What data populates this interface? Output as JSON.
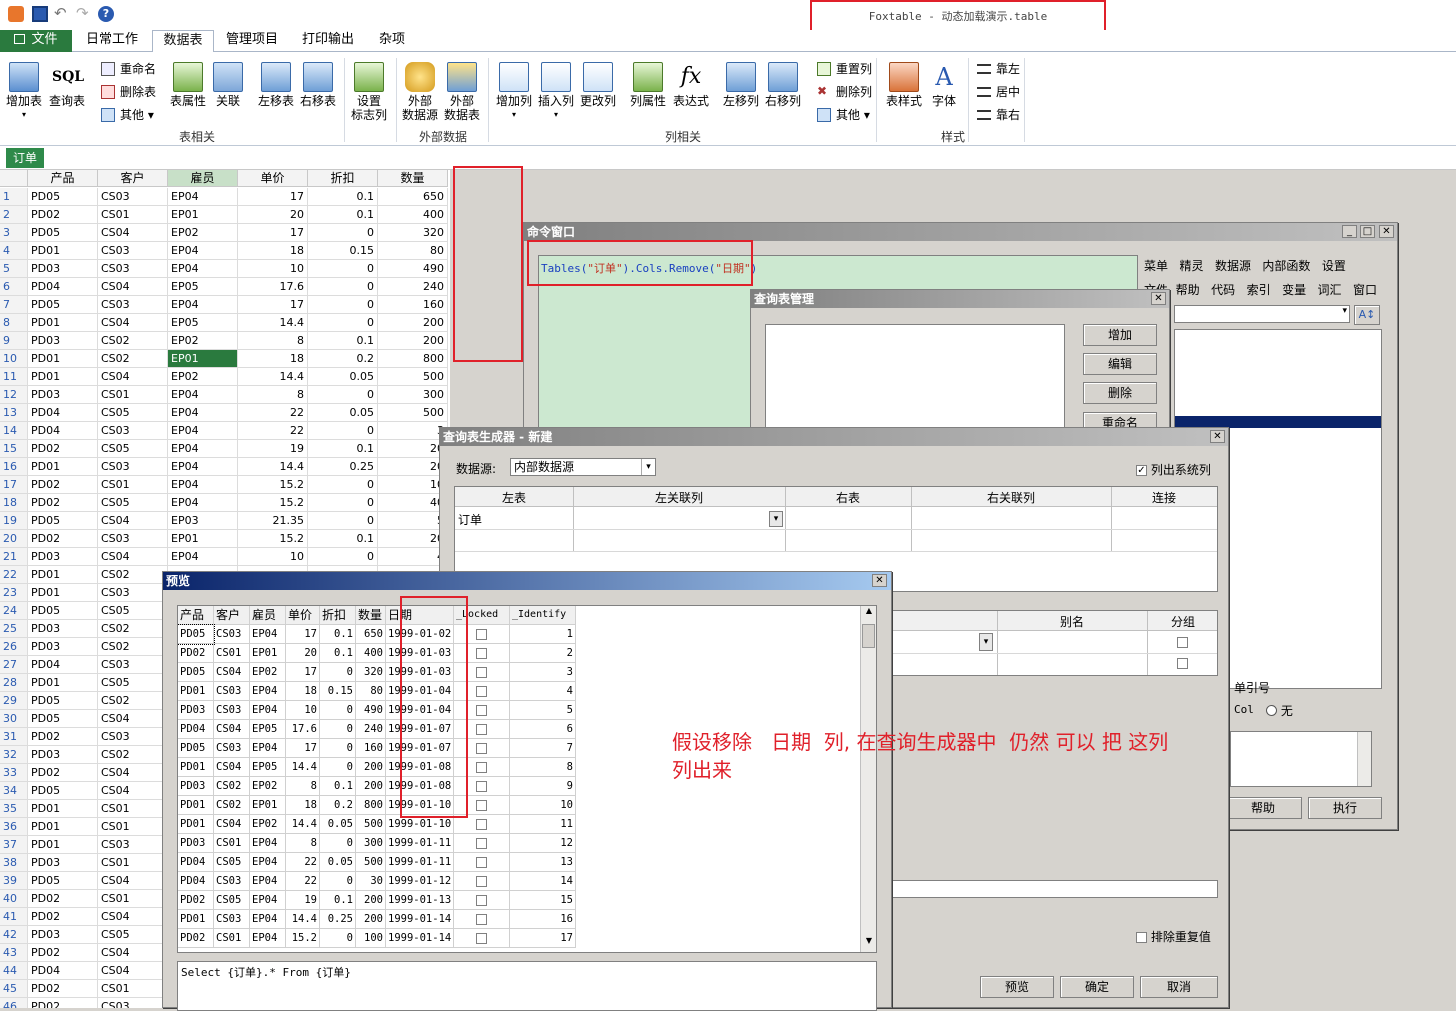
{
  "app_title": "Foxtable - 动态加载演示.table",
  "tabs": [
    "文件",
    "日常工作",
    "数据表",
    "管理项目",
    "打印输出",
    "杂项"
  ],
  "ribbon": {
    "add_table": "增加表",
    "sql_query": "查询表",
    "rename": "重命名",
    "delete_table": "删除表",
    "other": "其他",
    "table_props": "表属性",
    "relation": "关联",
    "move_left": "左移表",
    "move_right": "右移表",
    "set_flag": "设置\n标志列",
    "ext_source": "外部\n数据源",
    "ext_table": "外部\n数据表",
    "add_col": "增加列",
    "insert_col": "插入列",
    "change_col": "更改列",
    "col_props": "列属性",
    "expression": "表达式",
    "col_left": "左移列",
    "col_right": "右移列",
    "reset_col": "重置列",
    "delete_col": "删除列",
    "other2": "其他",
    "table_style": "表样式",
    "font": "字体",
    "align_left": "靠左",
    "align_center": "居中",
    "align_right": "靠右",
    "group_table": "表相关",
    "group_external": "外部数据",
    "group_column": "列相关",
    "group_style": "样式"
  },
  "doc_tab": "订单",
  "grid": {
    "headers": [
      "产品",
      "客户",
      "雇员",
      "单价",
      "折扣",
      "数量"
    ],
    "rows": [
      [
        "PD05",
        "CS03",
        "EP04",
        "17",
        "0.1",
        "650"
      ],
      [
        "PD02",
        "CS01",
        "EP01",
        "20",
        "0.1",
        "400"
      ],
      [
        "PD05",
        "CS04",
        "EP02",
        "17",
        "0",
        "320"
      ],
      [
        "PD01",
        "CS03",
        "EP04",
        "18",
        "0.15",
        "80"
      ],
      [
        "PD03",
        "CS03",
        "EP04",
        "10",
        "0",
        "490"
      ],
      [
        "PD04",
        "CS04",
        "EP05",
        "17.6",
        "0",
        "240"
      ],
      [
        "PD05",
        "CS03",
        "EP04",
        "17",
        "0",
        "160"
      ],
      [
        "PD01",
        "CS04",
        "EP05",
        "14.4",
        "0",
        "200"
      ],
      [
        "PD03",
        "CS02",
        "EP02",
        "8",
        "0.1",
        "200"
      ],
      [
        "PD01",
        "CS02",
        "EP01",
        "18",
        "0.2",
        "800"
      ],
      [
        "PD01",
        "CS04",
        "EP02",
        "14.4",
        "0.05",
        "500"
      ],
      [
        "PD03",
        "CS01",
        "EP04",
        "8",
        "0",
        "300"
      ],
      [
        "PD04",
        "CS05",
        "EP04",
        "22",
        "0.05",
        "500"
      ],
      [
        "PD04",
        "CS03",
        "EP04",
        "22",
        "0",
        "3"
      ],
      [
        "PD02",
        "CS05",
        "EP04",
        "19",
        "0.1",
        "20"
      ],
      [
        "PD01",
        "CS03",
        "EP04",
        "14.4",
        "0.25",
        "20"
      ],
      [
        "PD02",
        "CS01",
        "EP04",
        "15.2",
        "0",
        "10"
      ],
      [
        "PD02",
        "CS05",
        "EP04",
        "15.2",
        "0",
        "40"
      ],
      [
        "PD05",
        "CS04",
        "EP03",
        "21.35",
        "0",
        "5"
      ],
      [
        "PD02",
        "CS03",
        "EP01",
        "15.2",
        "0.1",
        "20"
      ],
      [
        "PD03",
        "CS04",
        "EP04",
        "10",
        "0",
        "4"
      ],
      [
        "PD01",
        "CS02",
        "",
        "",
        "",
        ""
      ],
      [
        "PD01",
        "CS03",
        "",
        "",
        "",
        ""
      ],
      [
        "PD05",
        "CS05",
        "",
        "",
        "",
        ""
      ],
      [
        "PD03",
        "CS02",
        "",
        "",
        "",
        ""
      ],
      [
        "PD03",
        "CS02",
        "",
        "",
        "",
        ""
      ],
      [
        "PD04",
        "CS03",
        "",
        "",
        "",
        ""
      ],
      [
        "PD01",
        "CS05",
        "",
        "",
        "",
        ""
      ],
      [
        "PD05",
        "CS02",
        "",
        "",
        "",
        ""
      ],
      [
        "PD05",
        "CS04",
        "",
        "",
        "",
        ""
      ],
      [
        "PD02",
        "CS03",
        "",
        "",
        "",
        ""
      ],
      [
        "PD03",
        "CS02",
        "",
        "",
        "",
        ""
      ],
      [
        "PD02",
        "CS04",
        "",
        "",
        "",
        ""
      ],
      [
        "PD05",
        "CS04",
        "",
        "",
        "",
        ""
      ],
      [
        "PD01",
        "CS01",
        "",
        "",
        "",
        ""
      ],
      [
        "PD01",
        "CS01",
        "",
        "",
        "",
        ""
      ],
      [
        "PD01",
        "CS03",
        "",
        "",
        "",
        ""
      ],
      [
        "PD03",
        "CS01",
        "",
        "",
        "",
        ""
      ],
      [
        "PD05",
        "CS04",
        "",
        "",
        "",
        ""
      ],
      [
        "PD02",
        "CS01",
        "",
        "",
        "",
        ""
      ],
      [
        "PD02",
        "CS04",
        "",
        "",
        "",
        ""
      ],
      [
        "PD03",
        "CS05",
        "",
        "",
        "",
        ""
      ],
      [
        "PD02",
        "CS04",
        "",
        "",
        "",
        ""
      ],
      [
        "PD04",
        "CS04",
        "",
        "",
        "",
        ""
      ],
      [
        "PD02",
        "CS01",
        "",
        "",
        "",
        ""
      ],
      [
        "PD02",
        "CS03",
        "",
        "",
        "",
        ""
      ]
    ]
  },
  "cmd_window": {
    "title": "命令窗口",
    "code_prefix": "Tables(",
    "code_arg1": "\"订单\"",
    "code_mid": ").Cols.Remove(",
    "code_arg2": "\"日期\"",
    "code_suffix": ")",
    "menu1": [
      "菜单",
      "精灵",
      "数据源",
      "内部函数",
      "设置"
    ],
    "menu2": [
      "帮助",
      "代码",
      "索引",
      "变量",
      "词汇",
      "窗口"
    ],
    "menu2_partial": "文件",
    "help_btn": "帮助",
    "exec_btn": "执行",
    "row_ref": "单引号",
    "col_label": "Col",
    "radio_none": "无"
  },
  "query_mgr": {
    "title": "查询表管理",
    "add": "增加",
    "edit": "编辑",
    "delete": "删除",
    "rename": "重命名"
  },
  "query_builder": {
    "title": "查询表生成器 - 新建",
    "source_label": "数据源:",
    "source_value": "内部数据源",
    "list_system": "列出系统列",
    "join_headers": [
      "左表",
      "左关联列",
      "右表",
      "右关联列",
      "连接"
    ],
    "join_row": "订单",
    "field_headers": [
      "别名",
      "分组"
    ],
    "distinct": "排除重复值",
    "preview": "预览",
    "ok": "确定",
    "cancel": "取消"
  },
  "preview": {
    "title": "预览",
    "headers": [
      "产品",
      "客户",
      "雇员",
      "单价",
      "折扣",
      "数量",
      "日期",
      "_Locked",
      "_Identify"
    ],
    "rows": [
      [
        "PD05",
        "CS03",
        "EP04",
        "17",
        "0.1",
        "650",
        "1999-01-02",
        "1"
      ],
      [
        "PD02",
        "CS01",
        "EP01",
        "20",
        "0.1",
        "400",
        "1999-01-03",
        "2"
      ],
      [
        "PD05",
        "CS04",
        "EP02",
        "17",
        "0",
        "320",
        "1999-01-03",
        "3"
      ],
      [
        "PD01",
        "CS03",
        "EP04",
        "18",
        "0.15",
        "80",
        "1999-01-04",
        "4"
      ],
      [
        "PD03",
        "CS03",
        "EP04",
        "10",
        "0",
        "490",
        "1999-01-04",
        "5"
      ],
      [
        "PD04",
        "CS04",
        "EP05",
        "17.6",
        "0",
        "240",
        "1999-01-07",
        "6"
      ],
      [
        "PD05",
        "CS03",
        "EP04",
        "17",
        "0",
        "160",
        "1999-01-07",
        "7"
      ],
      [
        "PD01",
        "CS04",
        "EP05",
        "14.4",
        "0",
        "200",
        "1999-01-08",
        "8"
      ],
      [
        "PD03",
        "CS02",
        "EP02",
        "8",
        "0.1",
        "200",
        "1999-01-08",
        "9"
      ],
      [
        "PD01",
        "CS02",
        "EP01",
        "18",
        "0.2",
        "800",
        "1999-01-10",
        "10"
      ],
      [
        "PD01",
        "CS04",
        "EP02",
        "14.4",
        "0.05",
        "500",
        "1999-01-10",
        "11"
      ],
      [
        "PD03",
        "CS01",
        "EP04",
        "8",
        "0",
        "300",
        "1999-01-11",
        "12"
      ],
      [
        "PD04",
        "CS05",
        "EP04",
        "22",
        "0.05",
        "500",
        "1999-01-11",
        "13"
      ],
      [
        "PD04",
        "CS03",
        "EP04",
        "22",
        "0",
        "30",
        "1999-01-12",
        "14"
      ],
      [
        "PD02",
        "CS05",
        "EP04",
        "19",
        "0.1",
        "200",
        "1999-01-13",
        "15"
      ],
      [
        "PD01",
        "CS03",
        "EP04",
        "14.4",
        "0.25",
        "200",
        "1999-01-14",
        "16"
      ],
      [
        "PD02",
        "CS01",
        "EP04",
        "15.2",
        "0",
        "100",
        "1999-01-14",
        "17"
      ]
    ],
    "sql": "Select  {订单}.* From {订单}"
  },
  "annotation": "假设移除   日期  列, 在查询生成器中  仍然 可以 把 这列\n列出来"
}
